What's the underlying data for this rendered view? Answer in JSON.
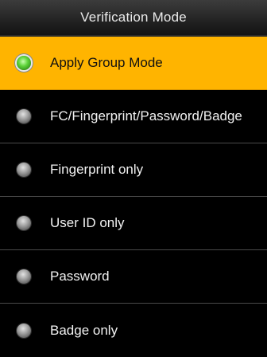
{
  "header": {
    "title": "Verification Mode"
  },
  "options": [
    {
      "label": "Apply Group Mode",
      "selected": true
    },
    {
      "label": "FC/Fingerprint/Password/Badge",
      "selected": false
    },
    {
      "label": "Fingerprint only",
      "selected": false
    },
    {
      "label": "User ID only",
      "selected": false
    },
    {
      "label": "Password",
      "selected": false
    },
    {
      "label": "Badge only",
      "selected": false
    }
  ],
  "colors": {
    "highlight": "#ffb400",
    "background": "#000000",
    "radio_on": "#5fd43a",
    "radio_off": "#9a9a9a"
  }
}
